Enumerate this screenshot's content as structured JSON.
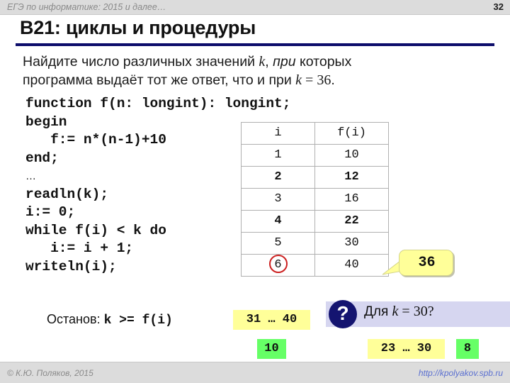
{
  "topbar": {
    "title": "ЕГЭ по информатике: 2015 и далее…",
    "page_number": "32"
  },
  "slide": {
    "title": "B21: циклы и процедуры",
    "rule_color": "#0d0d6b"
  },
  "question": {
    "line1_a": "Найдите число различных значений ",
    "line1_var": "k",
    "line1_b": ", ",
    "line1_it": "при",
    "line1_c": " которых",
    "line2_a": "программа выдаёт тот же ответ, что и при ",
    "line2_var": "k",
    "line2_eq": " = 36",
    "line2_end": "."
  },
  "code": {
    "lines": [
      "function f(n: longint): longint;",
      "begin",
      "   f:= n*(n-1)+10",
      "end;",
      "…",
      "readln(k);",
      "i:= 0;",
      "while f(i) < k do",
      "   i:= i + 1;",
      "writeln(i);"
    ],
    "text": "function f(n: longint): longint;\nbegin\n   f:= n*(n-1)+10\nend;"
  },
  "code_tail": {
    "ellipsis": "…",
    "text": "readln(k);\ni:= 0;\nwhile f(i) < k do\n   i:= i + 1;\nwriteln(i);"
  },
  "table": {
    "headers": [
      "i",
      "f(i)"
    ],
    "rows": [
      {
        "i": "1",
        "f": "10",
        "bold": false
      },
      {
        "i": "2",
        "f": "12",
        "bold": true
      },
      {
        "i": "3",
        "f": "16",
        "bold": false
      },
      {
        "i": "4",
        "f": "22",
        "bold": true
      },
      {
        "i": "5",
        "f": "30",
        "bold": false
      },
      {
        "i": "6",
        "f": "40",
        "bold": false,
        "circled": true
      }
    ]
  },
  "callout": {
    "value": "36",
    "fill": "#ffff99"
  },
  "stop": {
    "label": "Останов: ",
    "condition": "k >= f(i)"
  },
  "boxes": {
    "range1": "31 … 40",
    "answer1": "10",
    "range2": "23 … 30",
    "answer2": "8",
    "yellow": "#ffff99",
    "green": "#66ff66"
  },
  "ask": {
    "icon": "?",
    "prefix": "Для ",
    "var": "k",
    "value": " = 30?",
    "band_color": "#d6d6f0",
    "circle_color": "#141470"
  },
  "footer": {
    "copyright": "© К.Ю. Поляков, 2015",
    "url": "http://kpolyakov.spb.ru"
  }
}
